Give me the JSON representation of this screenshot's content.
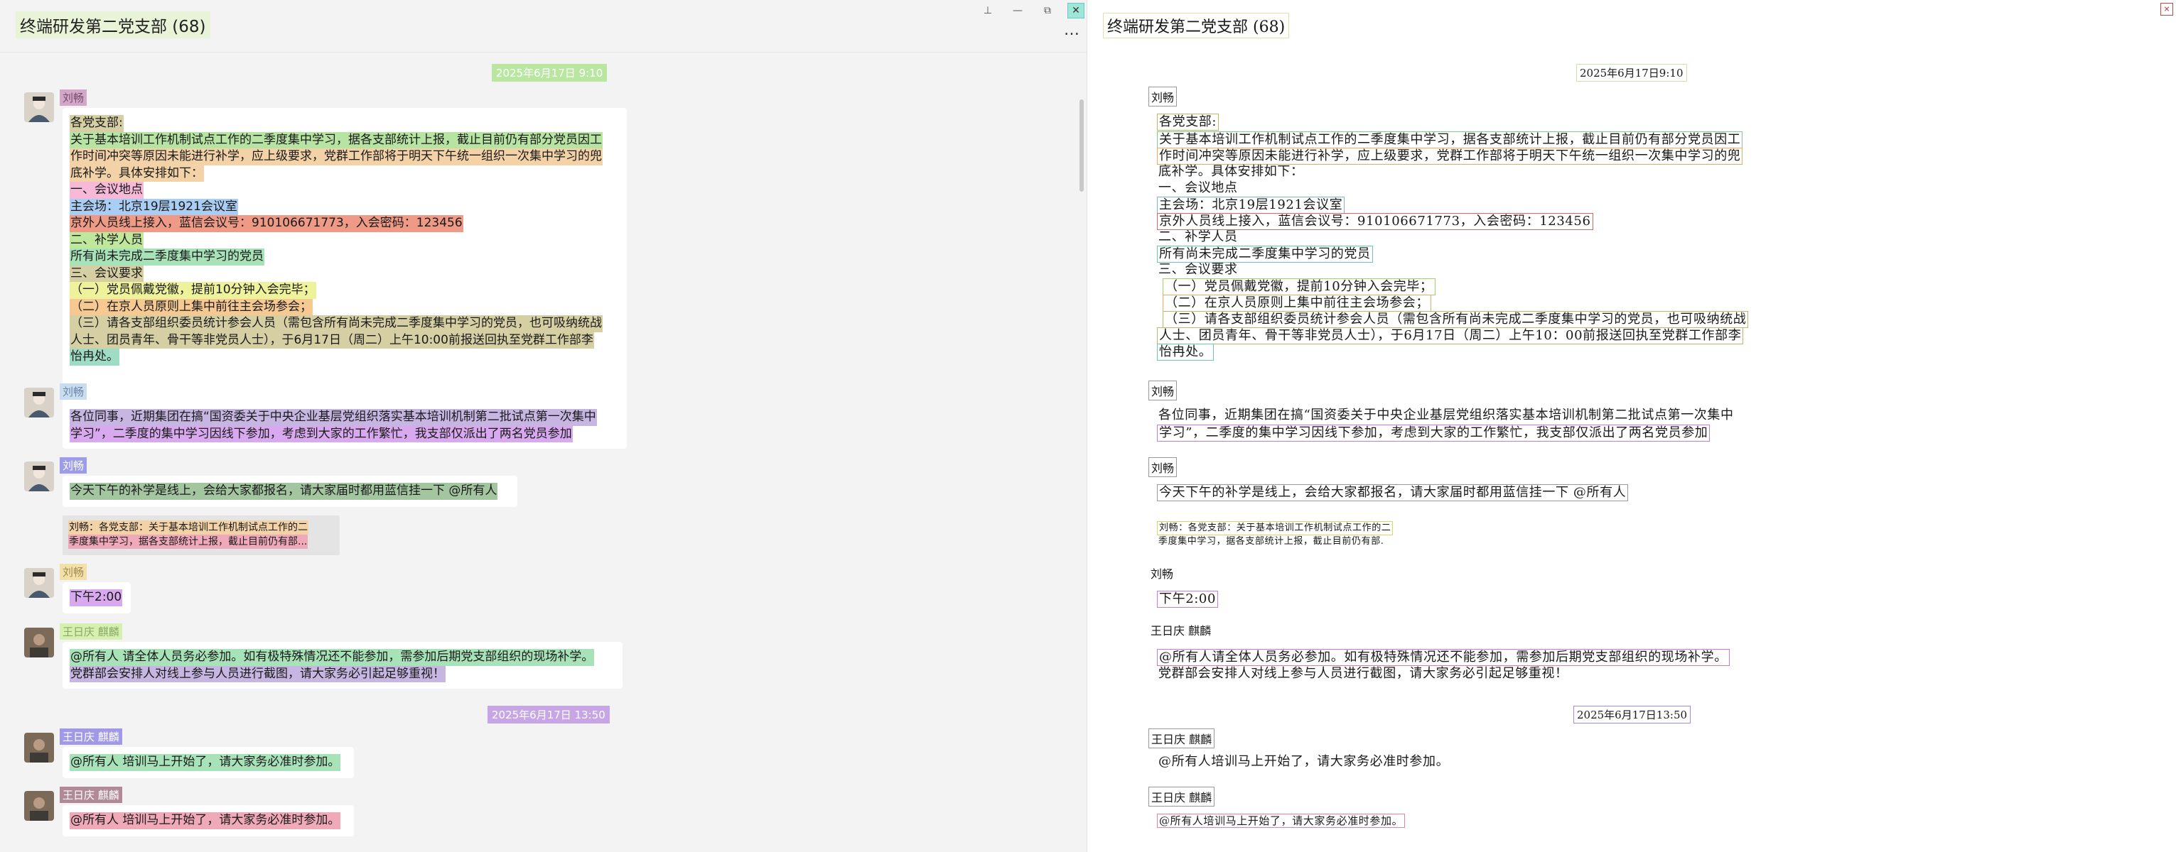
{
  "window": {
    "title": "终端研发第二党支部 (68)",
    "controls": {
      "pin": "⊥",
      "minimize": "—",
      "maximize": "⧉",
      "close": "✕"
    },
    "more": "…"
  },
  "colors": {
    "background": "#f3f3f3",
    "bubble": "#ffffff",
    "quote_bg": "#e4e4e4"
  },
  "messages": [
    {
      "type": "timestamp",
      "text": "2025年6月17日 9:10"
    },
    {
      "type": "message",
      "sender": "刘畅",
      "lines": [
        "各党支部:",
        "关于基本培训工作机制试点工作的二季度集中学习，据各支部统计上报，截止目前仍有部分党员因工",
        "作时间冲突等原因未能进行补学，应上级要求，党群工作部将于明天下午统一组织一次集中学习的兜",
        "底补学。具体安排如下：",
        "一、会议地点",
        "主会场：北京19层1921会议室",
        "京外人员线上接入，蓝信会议号：910106671773，入会密码：123456",
        "二、补学人员",
        "所有尚未完成二季度集中学习的党员",
        "三、会议要求",
        "（一）党员佩戴党徽，提前10分钟入会完毕；",
        "（二）在京人员原则上集中前往主会场参会；",
        "（三）请各支部组织委员统计参会人员（需包含所有尚未完成二季度集中学习的党员，也可吸纳统战",
        "人士、团员青年、骨干等非党员人士），于6月17日（周二）上午10:00前报送回执至党群工作部李",
        "怡冉处。"
      ]
    },
    {
      "type": "message",
      "sender": "刘畅",
      "lines": [
        "各位同事，近期集团在搞“国资委关于中央企业基层党组织落实基本培训机制第二批试点第一次集中",
        "学习”，二季度的集中学习因线下参加，考虑到大家的工作繁忙，我支部仅派出了两名党员参加"
      ]
    },
    {
      "type": "message",
      "sender": "刘畅",
      "lines": [
        "今天下午的补学是线上，会给大家都报名，请大家届时都用蓝信挂一下 @所有人"
      ],
      "quote": [
        "刘畅：各党支部：关于基本培训工作机制试点工作的二",
        "季度集中学习，据各支部统计上报，截止目前仍有部..."
      ]
    },
    {
      "type": "message",
      "sender": "刘畅",
      "lines": [
        "下午2:00"
      ]
    },
    {
      "type": "message",
      "sender": "王日庆 麒麟",
      "lines": [
        "@所有人 请全体人员务必参加。如有极特殊情况还不能参加，需参加后期党支部组织的现场补学。",
        "党群部会安排人对线上参与人员进行截图，请大家务必引起足够重视！"
      ]
    },
    {
      "type": "timestamp",
      "text": "2025年6月17日 13:50"
    },
    {
      "type": "message",
      "sender": "王日庆 麒麟",
      "lines": [
        "@所有人 培训马上开始了，请大家务必准时参加。"
      ]
    },
    {
      "type": "message",
      "sender": "王日庆 麒麟",
      "lines": [
        "@所有人 培训马上开始了，请大家务必准时参加。"
      ]
    }
  ],
  "render": {
    "title": "终端研发第二党支部 (68)",
    "close": "×",
    "timestamps": [
      "2025年6月17日9:10",
      "2025年6月17日13:50"
    ],
    "senders": [
      "刘畅",
      "刘畅",
      "刘畅",
      "刘畅",
      "王日庆 麒麟",
      "王日庆 麒麟",
      "王日庆 麒麟"
    ],
    "msg1": [
      "各党支部:",
      "关于基本培训工作机制试点工作的二季度集中学习，据各支部统计上报，截止目前仍有部分党员因工",
      "作时间冲突等原因未能进行补学，应上级要求，党群工作部将于明天下午统一组织一次集中学习的兜",
      "底补学。具体安排如下：",
      "一、会议地点",
      "主会场：北京19层1921会议室",
      "京外人员线上接入，蓝信会议号：910106671773，入会密码：123456",
      "二、补学人员",
      "所有尚未完成二季度集中学习的党员",
      "三、会议要求",
      "（一）党员佩戴党徽，提前10分钟入会完毕；",
      "（二）在京人员原则上集中前往主会场参会；",
      "（三）请各支部组织委员统计参会人员（需包含所有尚未完成二季度集中学习的党员，也可吸纳统战",
      "人士、团员青年、骨干等非党员人士），于6月17日（周二）上午10：00前报送回执至党群工作部李",
      "怡冉处。"
    ],
    "msg2": [
      "各位同事，近期集团在搞“国资委关于中央企业基层党组织落实基本培训机制第二批试点第一次集中",
      "学习”，二季度的集中学习因线下参加，考虑到大家的工作繁忙，我支部仅派出了两名党员参加"
    ],
    "msg3": "今天下午的补学是线上，会给大家都报名，请大家届时都用蓝信挂一下 @所有人",
    "quote": [
      "刘畅：各党支部：关于基本培训工作机制试点工作的二",
      "季度集中学习，据各支部统计上报，截止目前仍有部."
    ],
    "msg4": "下午2:00",
    "msg5": [
      "@所有人请全体人员务必参加。如有极特殊情况还不能参加，需参加后期党支部组织的现场补学。",
      "党群部会安排人对线上参与人员进行截图，请大家务必引起足够重视！"
    ],
    "msg6": "@所有人培训马上开始了，请大家务必准时参加。",
    "msg7": "@所有人培训马上开始了，请大家务必准时参加。"
  }
}
